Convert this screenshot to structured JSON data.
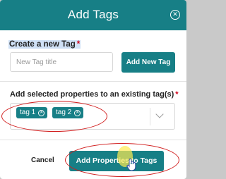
{
  "dialog": {
    "title": "Add Tags",
    "close_icon": "close-circle-icon"
  },
  "create_section": {
    "label": "Create a new Tag",
    "required_mark": "*",
    "input_value": "",
    "input_placeholder": "New Tag title",
    "button_label": "Add New Tag"
  },
  "existing_section": {
    "label": "Add selected properties to an existing tag(s)",
    "required_mark": "*",
    "selected_tags": [
      {
        "label": "tag 1",
        "remove_icon": "remove-circle-icon"
      },
      {
        "label": "tag 2",
        "remove_icon": "remove-circle-icon"
      }
    ],
    "dropdown_icon": "chevron-down-icon"
  },
  "footer": {
    "cancel_label": "Cancel",
    "submit_label": "Add Properties to Tags"
  },
  "colors": {
    "accent": "#177f86",
    "required": "#d0021b",
    "annotation": "#d11c1c",
    "selection_highlight": "#cfe0f5",
    "cursor_highlight": "#ffeb50"
  }
}
